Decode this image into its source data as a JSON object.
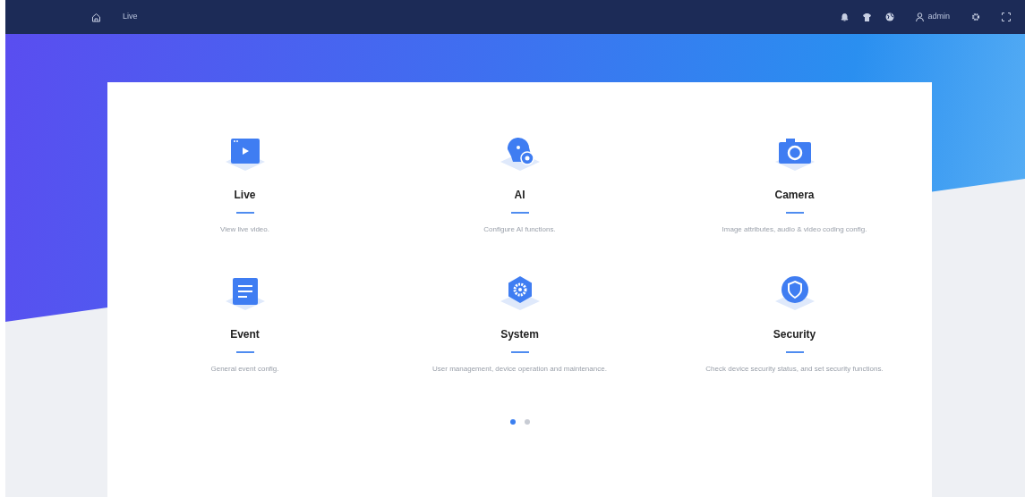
{
  "topbar": {
    "breadcrumb": "Live",
    "user": "admin"
  },
  "modules": [
    {
      "kind": "live",
      "title": "Live",
      "description": "View live video."
    },
    {
      "kind": "ai",
      "title": "AI",
      "description": "Configure AI functions."
    },
    {
      "kind": "camera",
      "title": "Camera",
      "description": "Image attributes, audio & video coding config."
    },
    {
      "kind": "event",
      "title": "Event",
      "description": "General event config."
    },
    {
      "kind": "system",
      "title": "System",
      "description": "User management, device operation and maintenance."
    },
    {
      "kind": "security",
      "title": "Security",
      "description": "Check device security status, and set security functions."
    }
  ],
  "pages": [
    {
      "selected": true
    },
    {
      "selected": false
    }
  ]
}
